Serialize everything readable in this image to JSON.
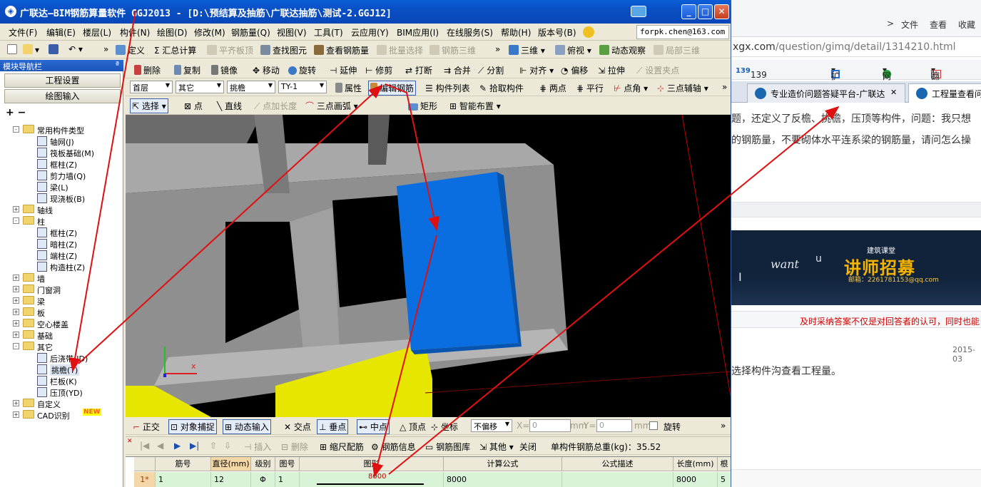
{
  "window": {
    "title": "广联达—BIM钢筋算量软件 GGJ2013 - [D:\\预结算及抽筋\\广联达抽筋\\测试-2.GGJ12]",
    "controls": {
      "minimize": "_",
      "maximize": "□",
      "close": "✕"
    }
  },
  "menubar": {
    "items": [
      "文件(F)",
      "编辑(E)",
      "楼层(L)",
      "构件(N)",
      "绘图(D)",
      "修改(M)",
      "钢筋量(Q)",
      "视图(V)",
      "工具(T)",
      "云应用(Y)",
      "BIM应用(I)",
      "在线服务(S)",
      "帮助(H)",
      "版本号(B)"
    ],
    "email": "forpk.chen@163.com"
  },
  "toolbar1": {
    "items": [
      "定义",
      "Σ 汇总计算",
      "平齐板顶",
      "查找图元",
      "查看钢筋量",
      "批量选择",
      "钢筋三维",
      "三维",
      "俯视",
      "动态观察",
      "局部三维"
    ]
  },
  "nav": {
    "title": "模块导航栏",
    "pin": "ª",
    "buttons": [
      "工程设置",
      "绘图输入"
    ],
    "tools": [
      "+",
      "−"
    ],
    "tree": [
      {
        "label": "常用构件类型",
        "exp": "-",
        "level": 0
      },
      {
        "label": "轴网(J)",
        "level": 1
      },
      {
        "label": "筏板基础(M)",
        "level": 1
      },
      {
        "label": "框柱(Z)",
        "level": 1
      },
      {
        "label": "剪力墙(Q)",
        "level": 1
      },
      {
        "label": "梁(L)",
        "level": 1
      },
      {
        "label": "现浇板(B)",
        "level": 1
      },
      {
        "label": "轴线",
        "exp": "+",
        "level": 0
      },
      {
        "label": "柱",
        "exp": "-",
        "level": 0
      },
      {
        "label": "框柱(Z)",
        "level": 1
      },
      {
        "label": "暗柱(Z)",
        "level": 1
      },
      {
        "label": "端柱(Z)",
        "level": 1
      },
      {
        "label": "构造柱(Z)",
        "level": 1
      },
      {
        "label": "墙",
        "exp": "+",
        "level": 0
      },
      {
        "label": "门窗洞",
        "exp": "+",
        "level": 0
      },
      {
        "label": "梁",
        "exp": "+",
        "level": 0
      },
      {
        "label": "板",
        "exp": "+",
        "level": 0
      },
      {
        "label": "空心楼盖",
        "exp": "+",
        "level": 0
      },
      {
        "label": "基础",
        "exp": "+",
        "level": 0
      },
      {
        "label": "其它",
        "exp": "-",
        "level": 0
      },
      {
        "label": "后浇带(JD)",
        "level": 1
      },
      {
        "label": "挑檐(T)",
        "level": 1,
        "selected": true
      },
      {
        "label": "栏板(K)",
        "level": 1
      },
      {
        "label": "压顶(YD)",
        "level": 1
      },
      {
        "label": "自定义",
        "exp": "+",
        "level": 0
      },
      {
        "label": "CAD识别",
        "exp": "+",
        "level": 0,
        "badge": "NEW"
      }
    ]
  },
  "toolbar2": {
    "items": [
      "删除",
      "复制",
      "镜像",
      "移动",
      "旋转",
      "延伸",
      "修剪",
      "打断",
      "合并",
      "分割",
      "对齐",
      "偏移",
      "拉伸",
      "设置夹点"
    ]
  },
  "toolbar3": {
    "floor": "首层",
    "category": "其它",
    "type": "挑檐",
    "component": "TY-1",
    "items": [
      "属性",
      "编辑钢筋",
      "构件列表",
      "拾取构件",
      "两点",
      "平行",
      "点角",
      "三点辅轴"
    ]
  },
  "toolbar4": {
    "items": [
      "选择",
      "点",
      "直线",
      "点加长度",
      "三点画弧",
      "矩形",
      "智能布置"
    ]
  },
  "snapbar": {
    "items": [
      "正交",
      "对象捕捉",
      "动态输入",
      "交点",
      "垂点",
      "中点",
      "顶点",
      "坐标"
    ],
    "offset_mode": "不偏移",
    "x_label": "X=",
    "x_value": "0",
    "x_unit": "mm",
    "y_label": "Y=",
    "y_value": "0",
    "y_unit": "mm",
    "rotate": "旋转"
  },
  "rebarbar": {
    "items": [
      "插入",
      "删除",
      "缩尺配筋",
      "钢筋信息",
      "钢筋图库",
      "其他",
      "关闭"
    ],
    "total": "单构件钢筋总重(kg)：35.52"
  },
  "grid": {
    "headers": [
      "",
      "筋号",
      "直径(mm)",
      "级别",
      "图号",
      "图形",
      "计算公式",
      "公式描述",
      "长度(mm)",
      "根"
    ],
    "row": {
      "index": "1*",
      "bar_no": "1",
      "diameter": "12",
      "grade": "Φ",
      "shape_no": "1",
      "shape_len": "8000",
      "formula": "8000",
      "desc": "",
      "length": "8000",
      "count": "5"
    }
  },
  "browser": {
    "menu": [
      "文件",
      "查看",
      "收藏"
    ],
    "url_domain": "xgx.com",
    "url_path": "/question/gimq/detail/1314210.html",
    "favorites": [
      "139邮箱",
      "扩展",
      "网银",
      "翻译"
    ],
    "tabs": [
      "专业造价问题答疑平台-广联达",
      "工程量查看问"
    ],
    "text_line1": "题，还定义了反檐、挑檐，压顶等构件，问题：我只想",
    "text_line2": "的钢筋量，不要砌体水平连系梁的钢筋量，请问怎么操",
    "banner_small": "建筑课堂",
    "banner_big": "讲师招募",
    "banner_email": "邮箱：2261781153@qq.com",
    "banner_want": "want",
    "banner_u": "u",
    "banner_i": "I",
    "notice": "及时采纳答案不仅是对回答者的认可，同时也能",
    "date": "2015-03",
    "answer": "选择构件沟查看工程量。"
  },
  "colors": {
    "accent_blue": "#0a4fc4",
    "arrow_red": "#e01010",
    "slab_blue": "#0a6de0",
    "grid_green": "#d8f3d8"
  }
}
